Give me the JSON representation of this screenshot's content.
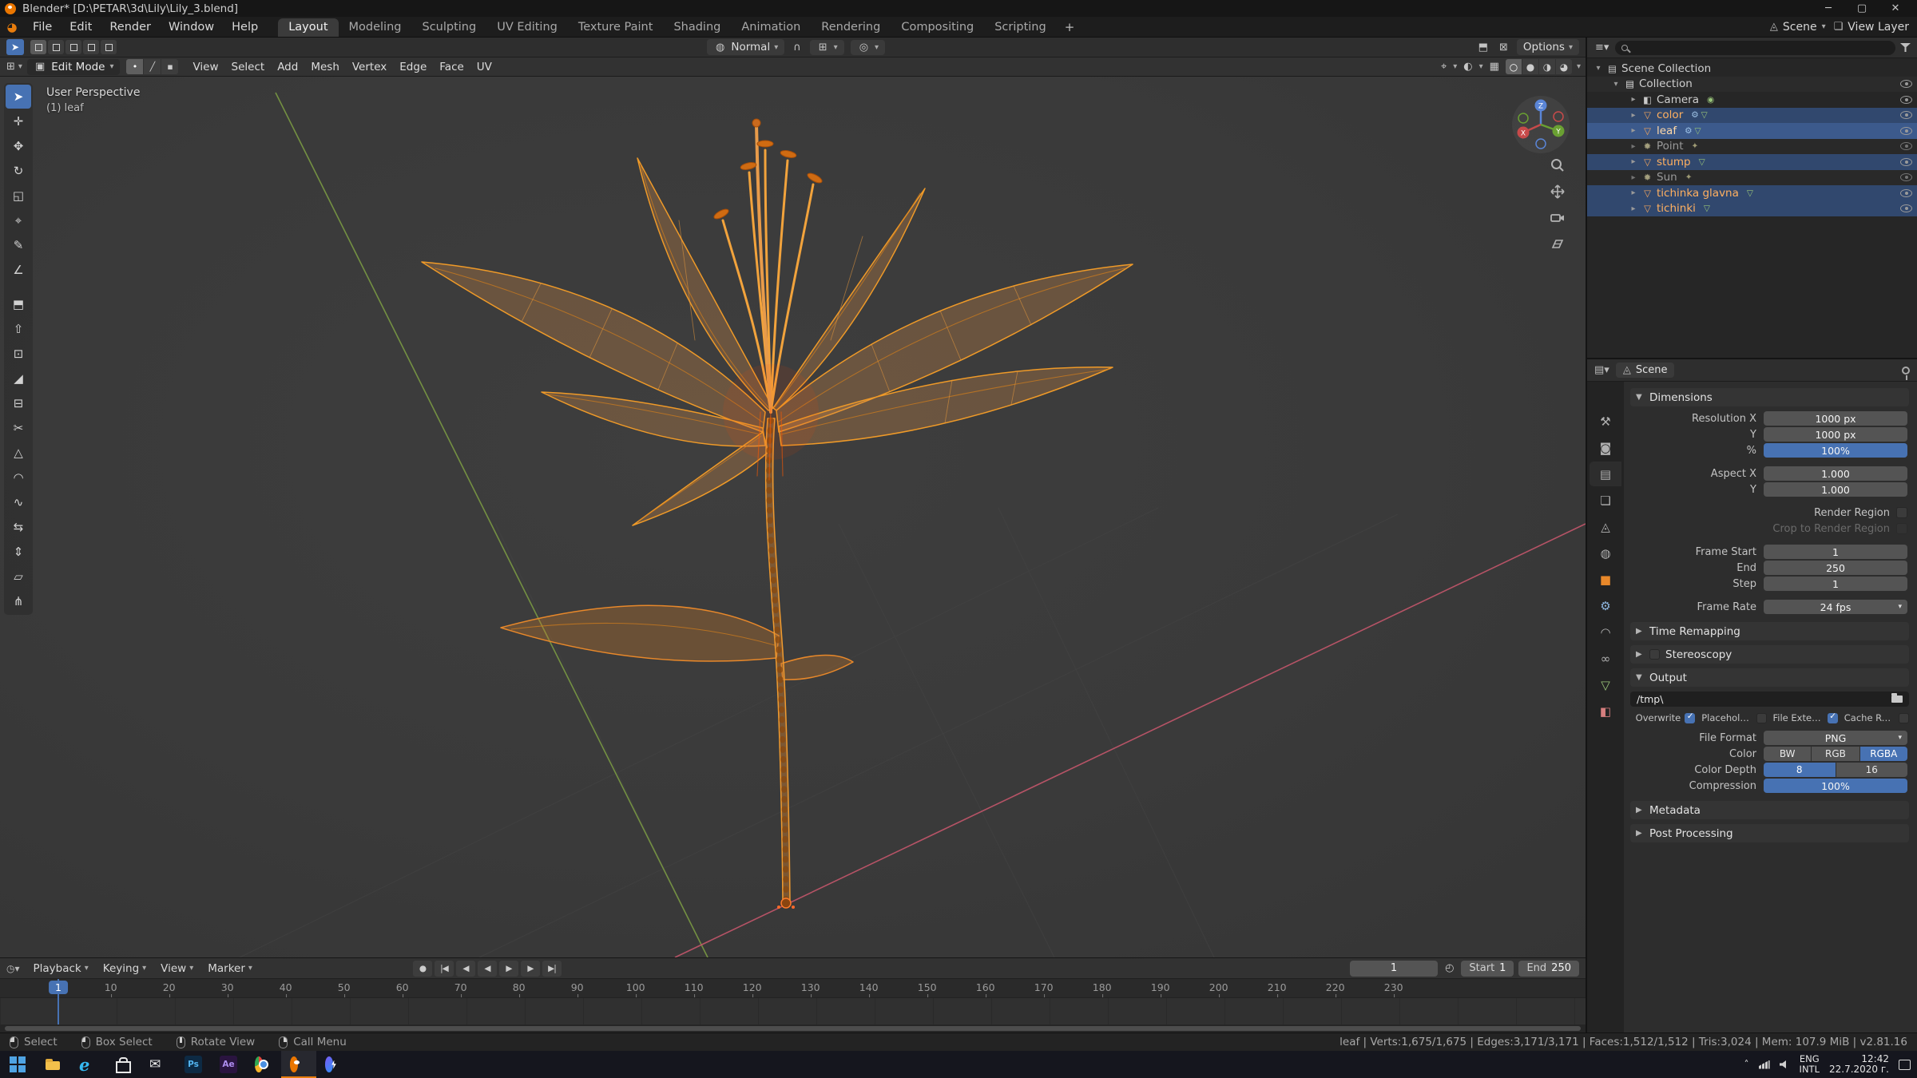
{
  "window": {
    "title": "Blender* [D:\\PETAR\\3d\\Lily\\Lily_3.blend]",
    "controls": {
      "minimize": "─",
      "maximize": "▢",
      "close": "✕"
    }
  },
  "topbar": {
    "menus": [
      {
        "label": "File"
      },
      {
        "label": "Edit"
      },
      {
        "label": "Render"
      },
      {
        "label": "Window"
      },
      {
        "label": "Help"
      }
    ],
    "workspaces": [
      {
        "label": "Layout",
        "active": true
      },
      {
        "label": "Modeling"
      },
      {
        "label": "Sculpting"
      },
      {
        "label": "UV Editing"
      },
      {
        "label": "Texture Paint"
      },
      {
        "label": "Shading"
      },
      {
        "label": "Animation"
      },
      {
        "label": "Rendering"
      },
      {
        "label": "Compositing"
      },
      {
        "label": "Scripting"
      }
    ],
    "add_workspace": "+",
    "scene": {
      "label": "Scene"
    },
    "view_layer": {
      "label": "View Layer"
    }
  },
  "tool_settings": {
    "orientation": "Normal",
    "options_label": "Options"
  },
  "viewport_header": {
    "mode": "Edit Mode",
    "menus": [
      {
        "label": "View"
      },
      {
        "label": "Select"
      },
      {
        "label": "Add"
      },
      {
        "label": "Mesh"
      },
      {
        "label": "Vertex"
      },
      {
        "label": "Edge"
      },
      {
        "label": "Face"
      },
      {
        "label": "UV"
      }
    ]
  },
  "viewport": {
    "overlay": {
      "line1": "User Perspective",
      "line2": "(1) leaf"
    },
    "gizmo_axes": {
      "x": "X",
      "y": "Y",
      "z": "Z"
    }
  },
  "tools": [
    {
      "name": "select-box",
      "glyph": "➤",
      "active": true
    },
    {
      "name": "cursor",
      "glyph": "✛"
    },
    {
      "name": "move",
      "glyph": "✥"
    },
    {
      "name": "rotate",
      "glyph": "↻"
    },
    {
      "name": "scale",
      "glyph": "◱"
    },
    {
      "name": "transform",
      "glyph": "⌖"
    },
    {
      "name": "annotate",
      "glyph": "✎"
    },
    {
      "name": "measure",
      "glyph": "∠"
    },
    {
      "name": "add-cube",
      "glyph": "⬒"
    },
    {
      "name": "extrude-region",
      "glyph": "⇧"
    },
    {
      "name": "inset-faces",
      "glyph": "⊡"
    },
    {
      "name": "bevel",
      "glyph": "◢"
    },
    {
      "name": "loop-cut",
      "glyph": "⊟"
    },
    {
      "name": "knife",
      "glyph": "✂"
    },
    {
      "name": "poly-build",
      "glyph": "△"
    },
    {
      "name": "spin",
      "glyph": "◠"
    },
    {
      "name": "smooth",
      "glyph": "∿"
    },
    {
      "name": "edge-slide",
      "glyph": "⇆"
    },
    {
      "name": "shrink-fatten",
      "glyph": "⇕"
    },
    {
      "name": "shear",
      "glyph": "▱"
    },
    {
      "name": "rip-region",
      "glyph": "⋔"
    }
  ],
  "outliner": {
    "rows": [
      {
        "label": "Scene Collection",
        "icon": "scene-collection",
        "depth": 0,
        "expanded": true,
        "no_eye": true
      },
      {
        "label": "Collection",
        "icon": "collection",
        "depth": 1,
        "expanded": true
      },
      {
        "label": "Camera",
        "icon": "camera",
        "depth": 2,
        "trail": [
          "camera-data"
        ]
      },
      {
        "label": "color",
        "icon": "mesh-object",
        "depth": 2,
        "selected": true,
        "orange": true,
        "trail": [
          "modifier",
          "mesh-data"
        ]
      },
      {
        "label": "leaf",
        "icon": "mesh-object",
        "depth": 2,
        "active": true,
        "orange": true,
        "trail": [
          "modifier",
          "mesh-data"
        ]
      },
      {
        "label": "Point",
        "icon": "light",
        "depth": 2,
        "dim": true,
        "trail": [
          "light-data"
        ]
      },
      {
        "label": "stump",
        "icon": "mesh-object",
        "depth": 2,
        "selected": true,
        "orange": true,
        "trail": [
          "mesh-data"
        ]
      },
      {
        "label": "Sun",
        "icon": "light",
        "depth": 2,
        "dim": true,
        "trail": [
          "light-data"
        ]
      },
      {
        "label": "tichinka glavna",
        "icon": "mesh-object",
        "depth": 2,
        "selected": true,
        "orange": true,
        "trail": [
          "mesh-data"
        ]
      },
      {
        "label": "tichinki",
        "icon": "mesh-object",
        "depth": 2,
        "selected": true,
        "orange": true,
        "trail": [
          "mesh-data"
        ]
      }
    ]
  },
  "properties": {
    "breadcrumb": {
      "scene_label": "Scene"
    },
    "tabs": [
      {
        "name": "tool",
        "glyph": "⚒"
      },
      {
        "name": "render",
        "glyph": "◙"
      },
      {
        "name": "output",
        "glyph": "▤",
        "active": true
      },
      {
        "name": "view-layer",
        "glyph": "❏"
      },
      {
        "name": "scene",
        "glyph": "◬"
      },
      {
        "name": "world",
        "glyph": "◍"
      },
      {
        "name": "object",
        "glyph": "■",
        "color": "#e8882a"
      },
      {
        "name": "modifiers",
        "glyph": "⚙",
        "color": "#8fb7e0"
      },
      {
        "name": "physics",
        "glyph": "◠"
      },
      {
        "name": "constraints",
        "glyph": "∞"
      },
      {
        "name": "object-data",
        "glyph": "▽",
        "color": "#98c379"
      },
      {
        "name": "material",
        "glyph": "◧",
        "color": "#d77f7f"
      }
    ],
    "panels": {
      "dimensions": {
        "title": "Dimensions",
        "fields": [
          {
            "label": "Resolution X",
            "value": "1000 px",
            "type": "number"
          },
          {
            "label": "Y",
            "value": "1000 px",
            "type": "number"
          },
          {
            "label": "%",
            "value": "100%",
            "type": "slider"
          },
          {
            "label": "Aspect X",
            "value": "1.000",
            "type": "number",
            "group": true
          },
          {
            "label": "Y",
            "value": "1.000",
            "type": "number"
          },
          {
            "label": "Render Region",
            "type": "checkbox",
            "group": true
          },
          {
            "label": "Crop to Render Region",
            "type": "checkbox",
            "disabled": true
          },
          {
            "label": "Frame Start",
            "value": "1",
            "type": "number",
            "group": true
          },
          {
            "label": "End",
            "value": "250",
            "type": "number"
          },
          {
            "label": "Step",
            "value": "1",
            "type": "number"
          },
          {
            "label": "Frame Rate",
            "value": "24 fps",
            "type": "dropdown",
            "group": true
          }
        ]
      },
      "time_remapping": {
        "title": "Time Remapping"
      },
      "stereoscopy": {
        "title": "Stereoscopy"
      },
      "output": {
        "title": "Output",
        "path": "/tmp\\",
        "checkboxes": [
          {
            "label": "Overwrite",
            "checked": true
          },
          {
            "label": "Placeholders"
          },
          {
            "label": "File Extensi...",
            "checked": true
          },
          {
            "label": "Cache Result"
          }
        ],
        "file_format": {
          "label": "File Format",
          "value": "PNG"
        },
        "color": {
          "label": "Color",
          "options": [
            {
              "label": "BW"
            },
            {
              "label": "RGB"
            },
            {
              "label": "RGBA",
              "selected": true
            }
          ]
        },
        "color_depth": {
          "label": "Color Depth",
          "options": [
            {
              "label": "8",
              "selected": true
            },
            {
              "label": "16"
            }
          ]
        },
        "compression": {
          "label": "Compression",
          "value": "100%"
        }
      },
      "metadata": {
        "title": "Metadata"
      },
      "post_processing": {
        "title": "Post Processing"
      }
    }
  },
  "timeline": {
    "menus": [
      {
        "label": "Playback",
        "dropdown": true
      },
      {
        "label": "Keying",
        "dropdown": true
      },
      {
        "label": "View"
      },
      {
        "label": "Marker"
      }
    ],
    "transport": [
      {
        "name": "auto-key",
        "glyph": "●"
      },
      {
        "name": "jump-start",
        "glyph": "|◀"
      },
      {
        "name": "prev-keyframe",
        "glyph": "◀"
      },
      {
        "name": "play-reverse",
        "glyph": "◀"
      },
      {
        "name": "play",
        "glyph": "▶"
      },
      {
        "name": "next-keyframe",
        "glyph": "▶"
      },
      {
        "name": "jump-end",
        "glyph": "▶|"
      }
    ],
    "ticks": [
      10,
      20,
      30,
      40,
      50,
      60,
      70,
      80,
      90,
      100,
      110,
      120,
      130,
      140,
      150,
      160,
      170,
      180,
      190,
      200,
      210,
      220,
      230
    ],
    "current_frame": "1",
    "fields": {
      "frame": "1",
      "start_label": "Start",
      "start": "1",
      "end_label": "End",
      "end": "250"
    }
  },
  "statusbar": {
    "hints": [
      {
        "button": "left",
        "label": "Select"
      },
      {
        "button": "left-drag",
        "label": "Box Select"
      },
      {
        "button": "middle",
        "label": "Rotate View"
      },
      {
        "button": "right",
        "label": "Call Menu"
      }
    ],
    "info": "leaf | Verts:1,675/1,675 | Edges:3,171/3,171 | Faces:1,512/1,512 | Tris:3,024 | Mem: 107.9 MiB | v2.81.16"
  },
  "taskbar": {
    "apps": [
      {
        "name": "start"
      },
      {
        "name": "file-explorer"
      },
      {
        "name": "edge"
      },
      {
        "name": "store"
      },
      {
        "name": "mail"
      },
      {
        "name": "photoshop",
        "text": "Ps"
      },
      {
        "name": "after-effects",
        "text": "Ae"
      },
      {
        "name": "chrome"
      },
      {
        "name": "blender",
        "active": true
      },
      {
        "name": "messenger"
      }
    ],
    "tray": {
      "lang_line1": "ENG",
      "lang_line2": "INTL",
      "time": "12:42",
      "date": "22.7.2020 г."
    }
  }
}
